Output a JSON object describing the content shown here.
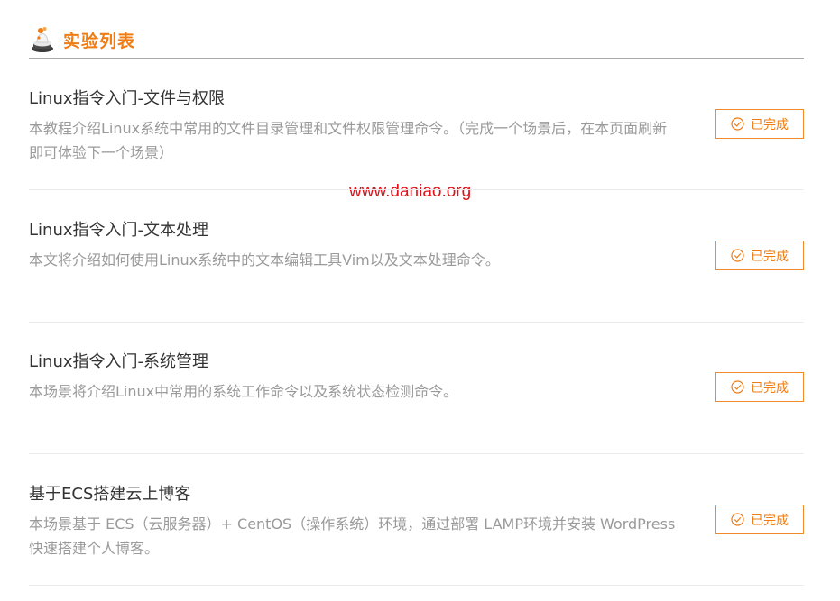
{
  "header": {
    "title": "实验列表",
    "icon": "lab-flask-icon"
  },
  "watermark": "www.daniao.org",
  "colors": {
    "accent": "#f07c14",
    "title_text": "#333333",
    "desc_text": "#9a9a9a",
    "watermark": "#e0121b"
  },
  "labs": [
    {
      "title": "Linux指令入门-文件与权限",
      "description": "本教程介绍Linux系统中常用的文件目录管理和文件权限管理命令。（完成一个场景后，在本页面刷新即可体验下一个场景）",
      "status": "已完成",
      "status_icon": "check-circle-icon"
    },
    {
      "title": "Linux指令入门-文本处理",
      "description": "本文将介绍如何使用Linux系统中的文本编辑工具Vim以及文本处理命令。",
      "status": "已完成",
      "status_icon": "check-circle-icon"
    },
    {
      "title": "Linux指令入门-系统管理",
      "description": "本场景将介绍Linux中常用的系统工作命令以及系统状态检测命令。",
      "status": "已完成",
      "status_icon": "check-circle-icon"
    },
    {
      "title": "基于ECS搭建云上博客",
      "description": "本场景基于 ECS（云服务器）+ CentOS（操作系统）环境，通过部署 LAMP环境并安装 WordPress 快速搭建个人博客。",
      "status": "已完成",
      "status_icon": "check-circle-icon"
    }
  ]
}
